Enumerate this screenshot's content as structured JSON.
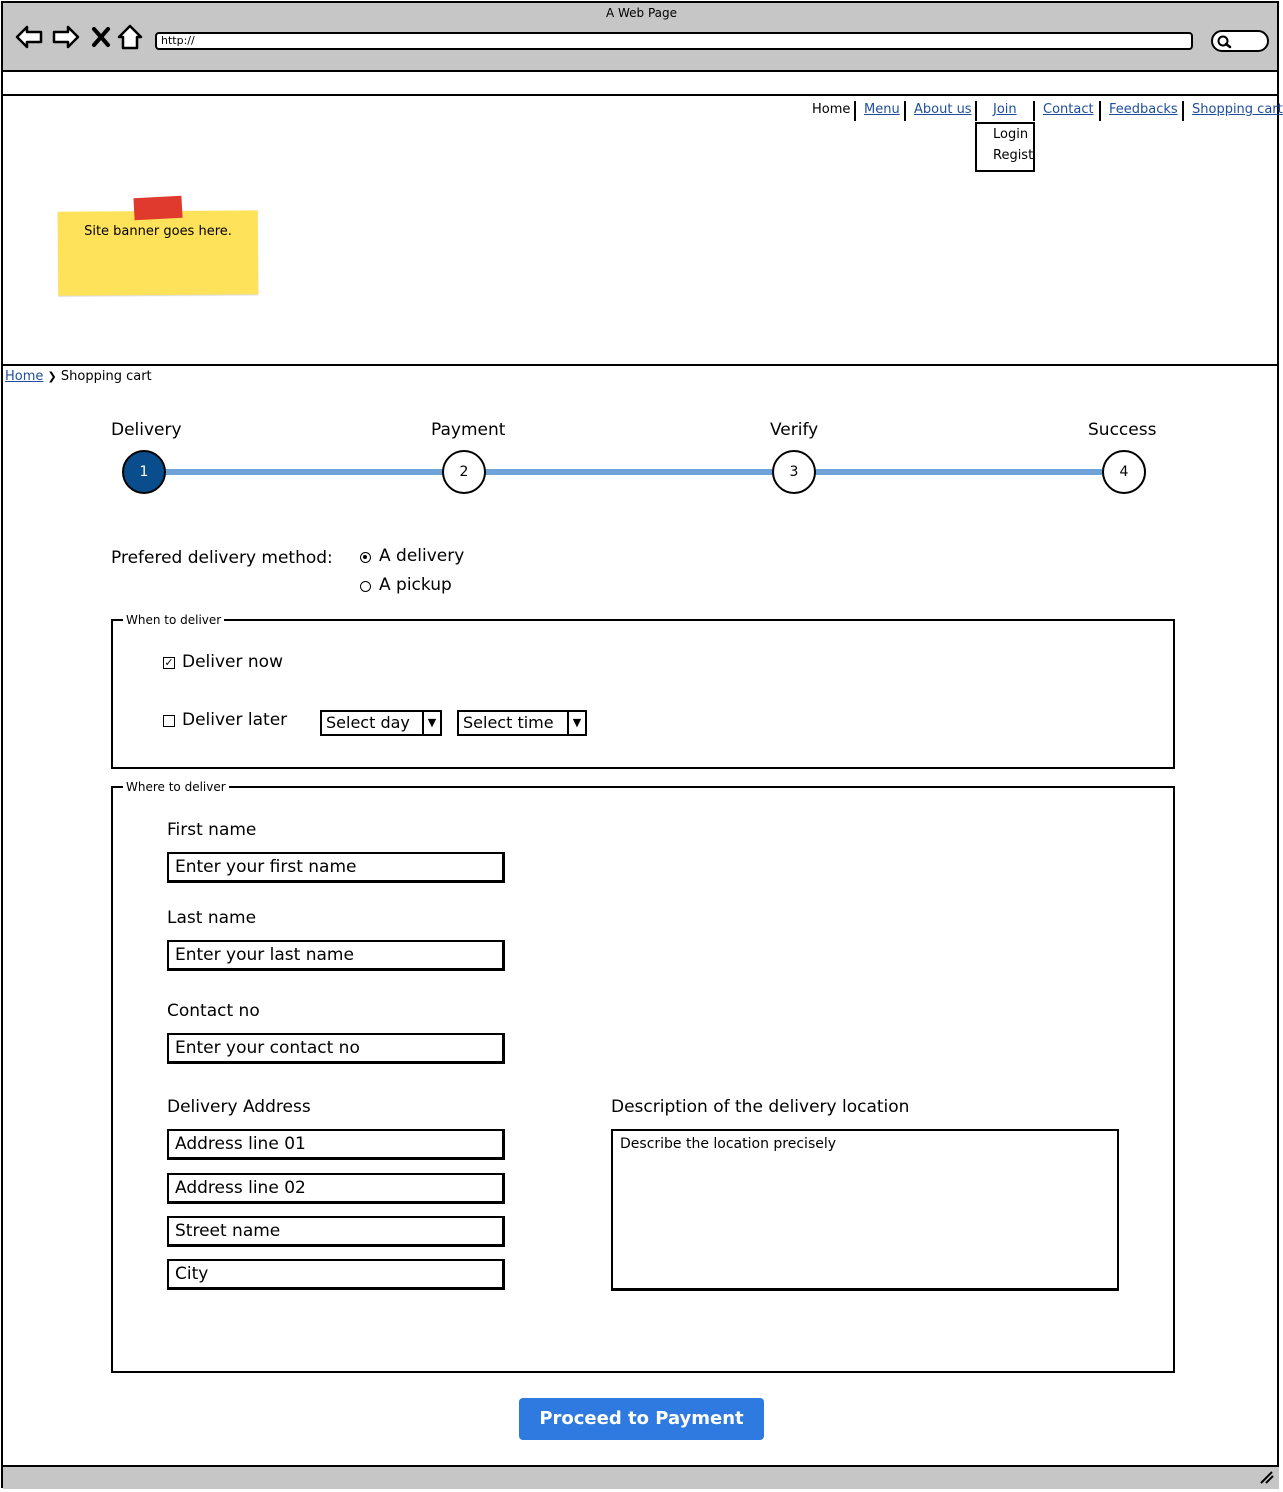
{
  "window": {
    "title": "A Web Page",
    "url": "http://"
  },
  "nav": {
    "items": [
      "Home",
      "Menu",
      "About us",
      "Join",
      "Contact",
      "Feedbacks",
      "Shopping cart"
    ],
    "join_menu": [
      "Login",
      "Regist"
    ]
  },
  "banner": {
    "text": "Site banner goes here."
  },
  "breadcrumb": {
    "home": "Home",
    "separator": "❯",
    "current": "Shopping cart"
  },
  "stepper": {
    "steps": [
      {
        "label": "Delivery",
        "number": "1"
      },
      {
        "label": "Payment",
        "number": "2"
      },
      {
        "label": "Verify",
        "number": "3"
      },
      {
        "label": "Success",
        "number": "4"
      }
    ],
    "active_step": 1
  },
  "delivery_method": {
    "label": "Prefered delivery method:",
    "options": [
      "A delivery",
      "A pickup"
    ],
    "selected": "A delivery"
  },
  "when": {
    "legend": "When to deliver",
    "deliver_now": "Deliver now",
    "deliver_now_checked": true,
    "deliver_later": "Deliver later",
    "deliver_later_checked": false,
    "day_select": "Select day",
    "time_select": "Select time"
  },
  "where": {
    "legend": "Where to deliver",
    "first_name_label": "First name",
    "first_name_placeholder": "Enter your first name",
    "last_name_label": "Last name",
    "last_name_placeholder": "Enter your last name",
    "contact_label": "Contact no",
    "contact_placeholder": "Enter your contact no",
    "address_label": "Delivery Address",
    "address_fields": [
      "Address line 01",
      "Address line 02",
      "Street name",
      "City"
    ],
    "description_label": "Description of the delivery location",
    "description_placeholder": "Describe the location precisely"
  },
  "proceed_label": "Proceed to Payment",
  "colors": {
    "accent": "#2f7ae0",
    "step_active": "#0a4d8c",
    "step_line": "#6fa3d8",
    "link": "#1f4e9f",
    "chrome": "#c6c6c6",
    "banner": "#fde25a"
  }
}
